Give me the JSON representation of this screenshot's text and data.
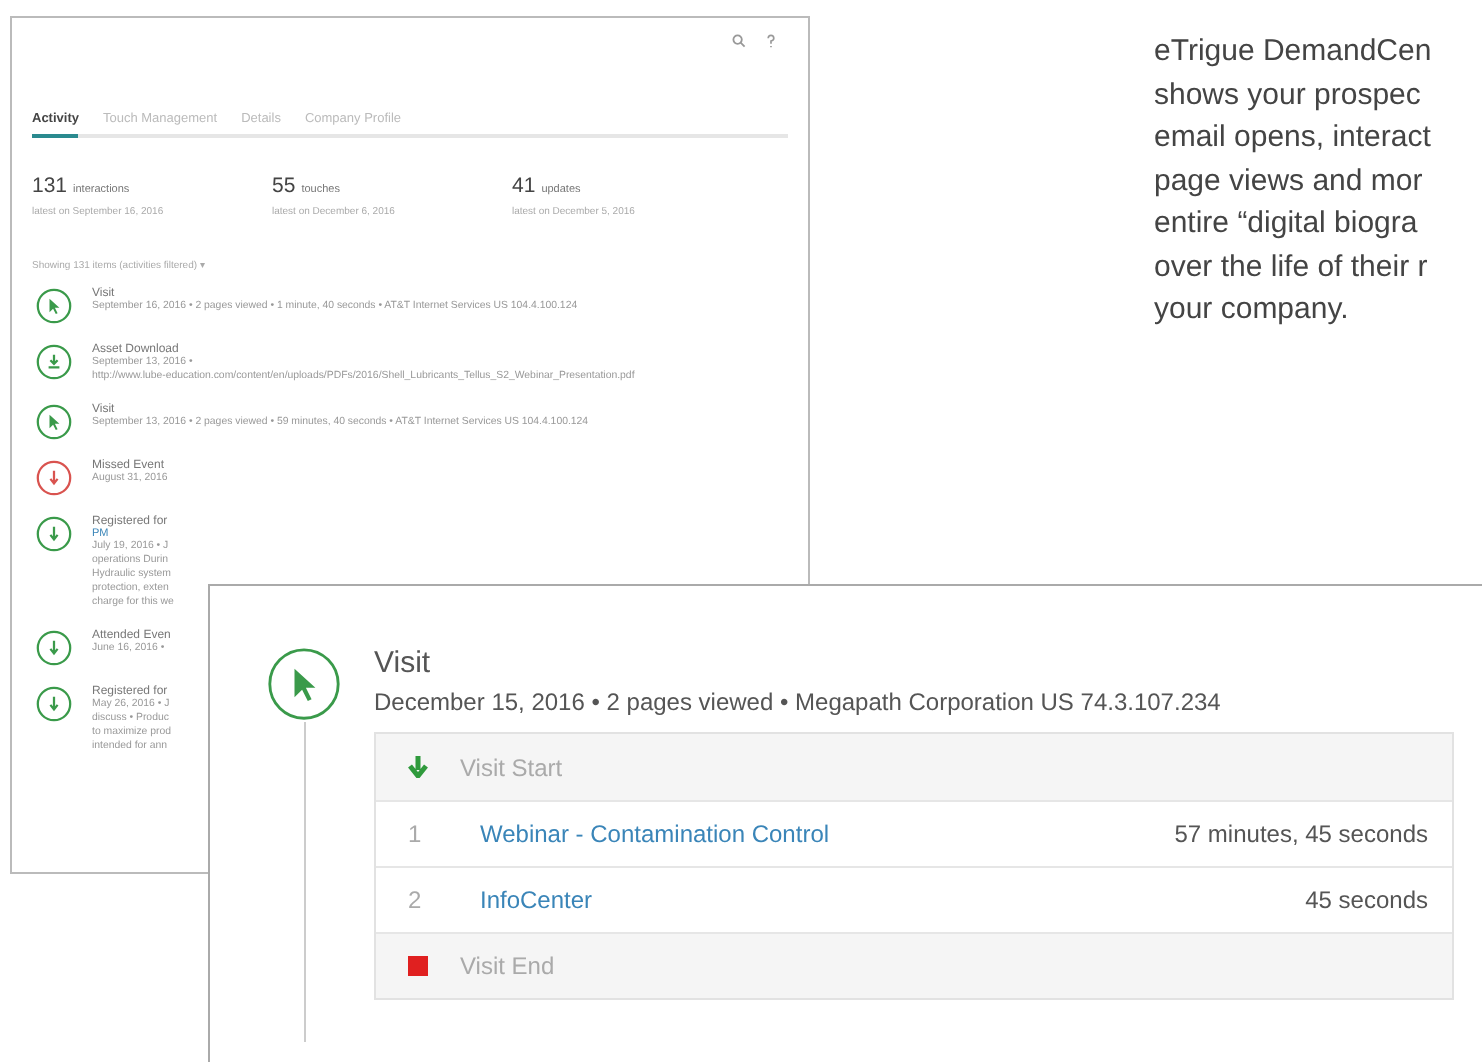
{
  "back_window": {
    "tabs": [
      {
        "label": "Activity",
        "selected": true
      },
      {
        "label": "Touch Management",
        "selected": false
      },
      {
        "label": "Details",
        "selected": false
      },
      {
        "label": "Company Profile",
        "selected": false
      }
    ],
    "stats": [
      {
        "value": "131",
        "unit": "interactions",
        "latest": "latest on September 16, 2016"
      },
      {
        "value": "55",
        "unit": "touches",
        "latest": "latest on December 6, 2016"
      },
      {
        "value": "41",
        "unit": "updates",
        "latest": "latest on December 5, 2016"
      }
    ],
    "filter": "Showing 131 items (activities filtered) ▾",
    "items": [
      {
        "kind": "visit",
        "title": "Visit",
        "lines": [
          "September 16, 2016 • 2 pages viewed • 1 minute, 40 seconds • AT&T Internet Services US 104.4.100.124"
        ]
      },
      {
        "kind": "download",
        "title": "Asset Download",
        "lines": [
          "September 13, 2016 •",
          "http://www.lube-education.com/content/en/uploads/PDFs/2016/Shell_Lubricants_Tellus_S2_Webinar_Presentation.pdf"
        ]
      },
      {
        "kind": "visit",
        "title": "Visit",
        "lines": [
          "September 13, 2016 • 2 pages viewed • 59 minutes, 40 seconds • AT&T Internet Services US 104.4.100.124"
        ]
      },
      {
        "kind": "missed",
        "title": "Missed Event",
        "lines": [
          "August 31, 2016"
        ]
      },
      {
        "kind": "registered",
        "title": "Registered for",
        "link": "PM",
        "lines": [
          "July 19, 2016 • J",
          "operations Durin",
          "Hydraulic system",
          "protection, exten",
          "charge for this we"
        ]
      },
      {
        "kind": "attended",
        "title": "Attended Even",
        "lines": [
          "June 16, 2016 •"
        ]
      },
      {
        "kind": "registered",
        "title": "Registered for",
        "lines": [
          "May 26, 2016 • J",
          "discuss • Produc",
          "to maximize prod",
          "intended for ann"
        ]
      }
    ]
  },
  "detail_panel": {
    "kind": "visit",
    "title": "Visit",
    "summary": "December 15, 2016 •  2 pages viewed • Megapath Corporation US 74.3.107.234",
    "rows": [
      {
        "kind": "start",
        "label": "Visit Start"
      },
      {
        "kind": "page",
        "number": "1",
        "label": "Webinar - Contamination Control",
        "duration": "57 minutes, 45 seconds"
      },
      {
        "kind": "page",
        "number": "2",
        "label": "InfoCenter",
        "duration": "45 seconds"
      },
      {
        "kind": "end",
        "label": "Visit End"
      }
    ]
  },
  "description_lines": [
    "eTrigue DemandCen",
    "shows your prospec",
    "email opens, interact",
    "page views and mor",
    "entire “digital biogra",
    "over the life of their r",
    "your company."
  ]
}
